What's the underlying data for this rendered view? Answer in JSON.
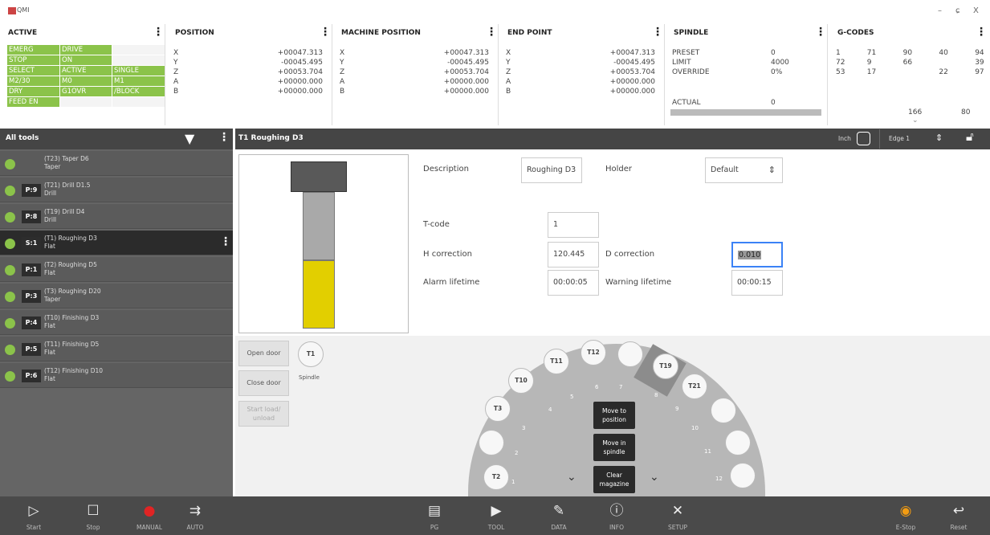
{
  "app": {
    "title": "QMI",
    "minimize": "–",
    "maximize": "ɕ",
    "close": "X"
  },
  "active": {
    "header": "ACTIVE",
    "cells": [
      [
        "EMERG",
        "DRIVE",
        ""
      ],
      [
        "STOP",
        "ON",
        ""
      ],
      [
        "SELECT",
        "ACTIVE",
        "SINGLE"
      ],
      [
        "M2/30",
        "M0",
        "M1"
      ],
      [
        "DRY",
        "G1OVR",
        "/BLOCK"
      ],
      [
        "FEED EN",
        "",
        ""
      ]
    ]
  },
  "position": {
    "header": "POSITION",
    "rows": [
      [
        "X",
        "+00047.313"
      ],
      [
        "Y",
        "-00045.495"
      ],
      [
        "Z",
        "+00053.704"
      ],
      [
        "A",
        "+00000.000"
      ],
      [
        "B",
        "+00000.000"
      ]
    ]
  },
  "machine_position": {
    "header": "MACHINE POSITION",
    "rows": [
      [
        "X",
        "+00047.313"
      ],
      [
        "Y",
        "-00045.495"
      ],
      [
        "Z",
        "+00053.704"
      ],
      [
        "A",
        "+00000.000"
      ],
      [
        "B",
        "+00000.000"
      ]
    ]
  },
  "end_point": {
    "header": "END POINT",
    "rows": [
      [
        "X",
        "+00047.313"
      ],
      [
        "Y",
        "-00045.495"
      ],
      [
        "Z",
        "+00053.704"
      ],
      [
        "A",
        "+00000.000"
      ],
      [
        "B",
        "+00000.000"
      ]
    ]
  },
  "spindle": {
    "header": "SPINDLE",
    "rows": [
      [
        "PRESET",
        "0"
      ],
      [
        "LIMIT",
        "4000"
      ],
      [
        "OVERRIDE",
        "0%"
      ]
    ],
    "actual_label": "ACTUAL",
    "actual_value": "0"
  },
  "gcodes": {
    "header": "G-CODES",
    "rows": [
      [
        "1",
        "71",
        "90",
        "40",
        "94"
      ],
      [
        "72",
        "9",
        "66",
        "",
        "39"
      ],
      [
        "53",
        "17",
        "",
        "22",
        "97"
      ]
    ],
    "extra": [
      "166",
      "80"
    ]
  },
  "tools_header": {
    "title": "All tools"
  },
  "tools": [
    {
      "pos": "",
      "name": "(T23) Taper D6",
      "type": "Taper"
    },
    {
      "pos": "P:9",
      "name": "(T21) Drill D1.5",
      "type": "Drill"
    },
    {
      "pos": "P:8",
      "name": "(T19) Drill D4",
      "type": "Drill"
    },
    {
      "pos": "S:1",
      "name": "(T1) Roughing D3",
      "type": "Flat"
    },
    {
      "pos": "P:1",
      "name": "(T2) Roughing D5",
      "type": "Flat"
    },
    {
      "pos": "P:3",
      "name": "(T3) Roughing D20",
      "type": "Taper"
    },
    {
      "pos": "P:4",
      "name": "(T10) Finishing D3",
      "type": "Flat"
    },
    {
      "pos": "P:5",
      "name": "(T11) Finishing D5",
      "type": "Flat"
    },
    {
      "pos": "P:6",
      "name": "(T12) Finishing D10",
      "type": "Flat"
    }
  ],
  "detail": {
    "title": "T1 Roughing D3",
    "inch": "Inch",
    "edge": "Edge 1",
    "description_label": "Description",
    "description": "Roughing D3",
    "holder_label": "Holder",
    "holder": "Default",
    "tcode_label": "T-code",
    "tcode": "1",
    "hcorr_label": "H correction",
    "hcorr": "120.445",
    "dcorr_label": "D correction",
    "dcorr": "0.010",
    "alarm_label": "Alarm lifetime",
    "alarm": "00:00:05",
    "warn_label": "Warning lifetime",
    "warn": "00:00:15"
  },
  "magazine": {
    "open_door": "Open door",
    "close_door": "Close door",
    "load": "Start load/ unload",
    "spindle_tool": "T1",
    "spindle_label": "Spindle",
    "move_to": "Move to position",
    "move_in": "Move in spindle",
    "clear": "Clear magazine"
  },
  "footer": {
    "start": "Start",
    "stop": "Stop",
    "manual": "MANUAL",
    "auto": "AUTO",
    "pg": "PG",
    "tool": "TOOL",
    "data": "DATA",
    "info": "INFO",
    "setup": "SETUP",
    "estop": "E-Stop",
    "reset": "Reset"
  }
}
